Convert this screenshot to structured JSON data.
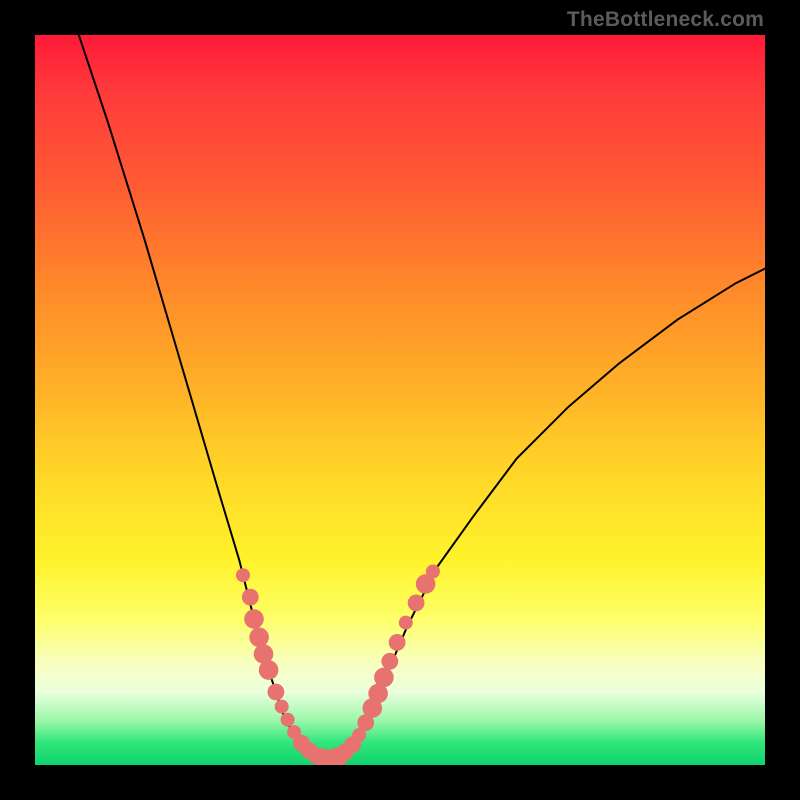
{
  "watermark": "TheBottleneck.com",
  "colors": {
    "dot_fill": "#e8726f",
    "curve_stroke": "#000000",
    "frame_bg": "#000000"
  },
  "chart_data": {
    "type": "line",
    "title": "",
    "xlabel": "",
    "ylabel": "",
    "xlim": [
      0,
      100
    ],
    "ylim": [
      0,
      100
    ],
    "curve": [
      {
        "x": 6,
        "y": 100
      },
      {
        "x": 10,
        "y": 88
      },
      {
        "x": 15,
        "y": 72
      },
      {
        "x": 20,
        "y": 55
      },
      {
        "x": 25,
        "y": 38
      },
      {
        "x": 28,
        "y": 28
      },
      {
        "x": 30,
        "y": 20
      },
      {
        "x": 32,
        "y": 13
      },
      {
        "x": 34,
        "y": 7
      },
      {
        "x": 36,
        "y": 3
      },
      {
        "x": 38,
        "y": 1
      },
      {
        "x": 40,
        "y": 0.5
      },
      {
        "x": 42,
        "y": 1
      },
      {
        "x": 44,
        "y": 3
      },
      {
        "x": 46,
        "y": 7
      },
      {
        "x": 48,
        "y": 12
      },
      {
        "x": 51,
        "y": 19
      },
      {
        "x": 55,
        "y": 27
      },
      {
        "x": 60,
        "y": 34
      },
      {
        "x": 66,
        "y": 42
      },
      {
        "x": 73,
        "y": 49
      },
      {
        "x": 80,
        "y": 55
      },
      {
        "x": 88,
        "y": 61
      },
      {
        "x": 96,
        "y": 66
      },
      {
        "x": 100,
        "y": 68
      }
    ],
    "points": [
      {
        "x": 28.5,
        "y": 26,
        "r": 1.0
      },
      {
        "x": 29.5,
        "y": 23,
        "r": 1.2
      },
      {
        "x": 30.0,
        "y": 20,
        "r": 1.4
      },
      {
        "x": 30.7,
        "y": 17.5,
        "r": 1.4
      },
      {
        "x": 31.3,
        "y": 15.2,
        "r": 1.4
      },
      {
        "x": 32.0,
        "y": 13,
        "r": 1.4
      },
      {
        "x": 33.0,
        "y": 10,
        "r": 1.2
      },
      {
        "x": 33.8,
        "y": 8,
        "r": 1.0
      },
      {
        "x": 34.6,
        "y": 6.2,
        "r": 1.0
      },
      {
        "x": 35.5,
        "y": 4.5,
        "r": 1.0
      },
      {
        "x": 36.5,
        "y": 3.0,
        "r": 1.2
      },
      {
        "x": 37.5,
        "y": 2.0,
        "r": 1.2
      },
      {
        "x": 38.5,
        "y": 1.3,
        "r": 1.2
      },
      {
        "x": 39.5,
        "y": 0.9,
        "r": 1.4
      },
      {
        "x": 40.5,
        "y": 0.8,
        "r": 1.4
      },
      {
        "x": 41.5,
        "y": 1.1,
        "r": 1.4
      },
      {
        "x": 42.5,
        "y": 1.8,
        "r": 1.2
      },
      {
        "x": 43.5,
        "y": 2.8,
        "r": 1.2
      },
      {
        "x": 44.4,
        "y": 4.1,
        "r": 1.0
      },
      {
        "x": 45.3,
        "y": 5.8,
        "r": 1.2
      },
      {
        "x": 46.2,
        "y": 7.8,
        "r": 1.4
      },
      {
        "x": 47.0,
        "y": 9.8,
        "r": 1.4
      },
      {
        "x": 47.8,
        "y": 12.0,
        "r": 1.4
      },
      {
        "x": 48.6,
        "y": 14.2,
        "r": 1.2
      },
      {
        "x": 49.6,
        "y": 16.8,
        "r": 1.2
      },
      {
        "x": 50.8,
        "y": 19.5,
        "r": 1.0
      },
      {
        "x": 52.2,
        "y": 22.2,
        "r": 1.2
      },
      {
        "x": 53.5,
        "y": 24.8,
        "r": 1.4
      },
      {
        "x": 54.5,
        "y": 26.5,
        "r": 1.0
      }
    ]
  }
}
